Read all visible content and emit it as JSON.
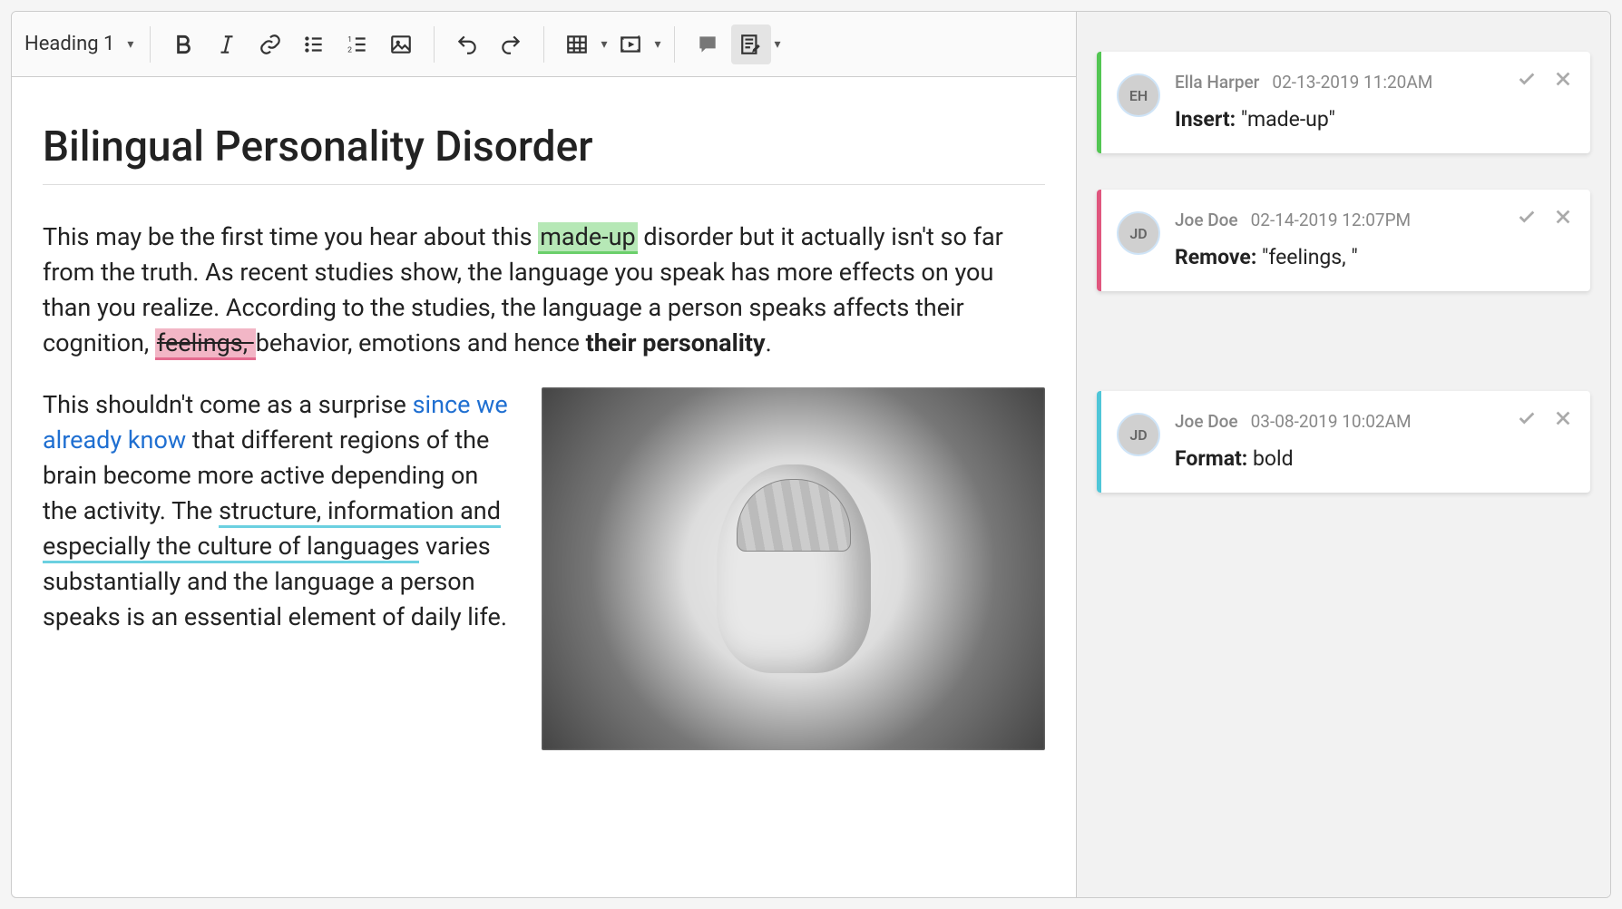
{
  "toolbar": {
    "heading_label": "Heading 1"
  },
  "document": {
    "title": "Bilingual Personality Disorder",
    "p1_a": "This may be the first time you hear about this ",
    "p1_ins": "made-up",
    "p1_b": " disorder but it actually isn't so far from the truth. As recent studies show, the language you speak has more effects on you than you realize. According to the studies, the language a person speaks affects their cognition, ",
    "p1_del": "feelings, ",
    "p1_c": "behavior, emotions and hence ",
    "p1_bold": "their personality",
    "p1_d": ".",
    "p2_a": "This shouldn't come as a surprise ",
    "p2_link": "since we already know",
    "p2_b": " that different regions of the brain become more active depending on the activity. The ",
    "p2_teal": "structure, information and especially the culture of languages",
    "p2_c": " varies substantially and the language a person speaks is an essential element of daily life."
  },
  "suggestions": [
    {
      "stripe": "green",
      "avatar_initials": "EH",
      "name": "Ella Harper",
      "date": "02-13-2019 11:20AM",
      "label": "Insert:",
      "value": "\"made-up\""
    },
    {
      "stripe": "pink",
      "avatar_initials": "JD",
      "name": "Joe Doe",
      "date": "02-14-2019 12:07PM",
      "label": "Remove:",
      "value": "\"feelings, \""
    },
    {
      "stripe": "teal",
      "avatar_initials": "JD",
      "name": "Joe Doe",
      "date": "03-08-2019 10:02AM",
      "label": "Format:",
      "value": "bold"
    }
  ]
}
